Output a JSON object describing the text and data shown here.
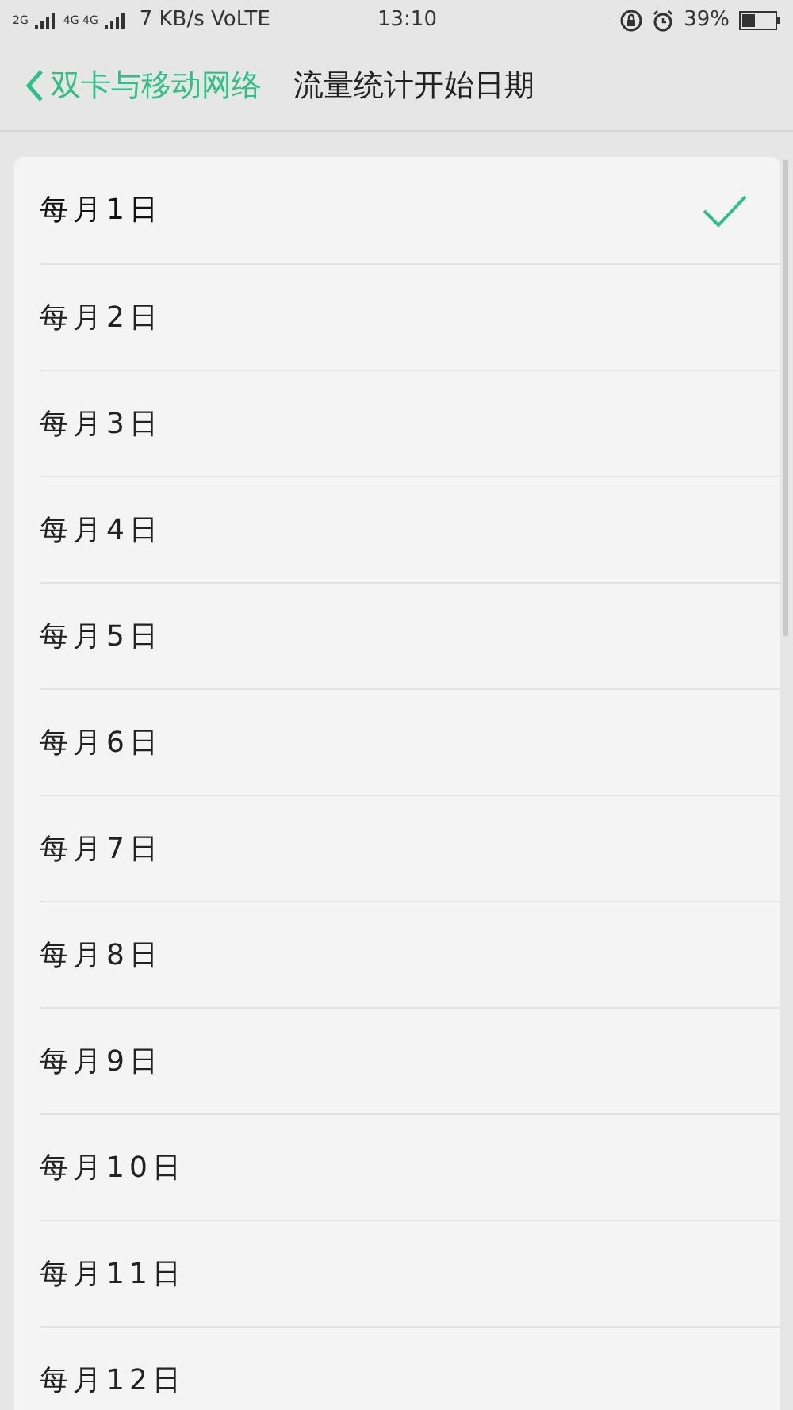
{
  "status_bar": {
    "sim1_label": "2G",
    "sim2_label": "4G 4G",
    "speed": "7 KB/s VoLTE",
    "time": "13:10",
    "battery": "39%"
  },
  "header": {
    "back_label": "双卡与移动网络",
    "title": "流量统计开始日期"
  },
  "options": [
    {
      "label": "每月1日",
      "selected": true
    },
    {
      "label": "每月2日",
      "selected": false
    },
    {
      "label": "每月3日",
      "selected": false
    },
    {
      "label": "每月4日",
      "selected": false
    },
    {
      "label": "每月5日",
      "selected": false
    },
    {
      "label": "每月6日",
      "selected": false
    },
    {
      "label": "每月7日",
      "selected": false
    },
    {
      "label": "每月8日",
      "selected": false
    },
    {
      "label": "每月9日",
      "selected": false
    },
    {
      "label": "每月10日",
      "selected": false
    },
    {
      "label": "每月11日",
      "selected": false
    },
    {
      "label": "每月12日",
      "selected": false
    }
  ]
}
